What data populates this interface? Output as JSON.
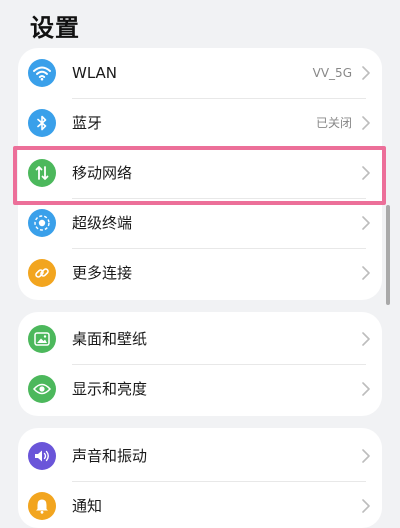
{
  "page": {
    "title": "设置"
  },
  "colors": {
    "wlan": "#3aa0ea",
    "bluetooth": "#3aa0ea",
    "mobile_network": "#4cb85c",
    "super_device": "#3aa0ea",
    "more_connections": "#f2a51f",
    "desktop": "#4cb85c",
    "display": "#4cb85c",
    "sound": "#6a55d9",
    "notification": "#f2a51f",
    "highlight": "#ec6f99"
  },
  "groups": [
    {
      "items": [
        {
          "label": "WLAN",
          "value": "VV_5G",
          "icon": "wifi-icon"
        },
        {
          "label": "蓝牙",
          "value": "已关闭",
          "icon": "bluetooth-icon"
        },
        {
          "label": "移动网络",
          "value": "",
          "icon": "mobile-data-icon"
        },
        {
          "label": "超级终端",
          "value": "",
          "icon": "super-device-icon"
        },
        {
          "label": "更多连接",
          "value": "",
          "icon": "link-icon"
        }
      ]
    },
    {
      "items": [
        {
          "label": "桌面和壁纸",
          "value": "",
          "icon": "wallpaper-icon"
        },
        {
          "label": "显示和亮度",
          "value": "",
          "icon": "eye-icon"
        }
      ]
    },
    {
      "items": [
        {
          "label": "声音和振动",
          "value": "",
          "icon": "speaker-icon"
        },
        {
          "label": "通知",
          "value": "",
          "icon": "bell-icon"
        }
      ]
    }
  ]
}
